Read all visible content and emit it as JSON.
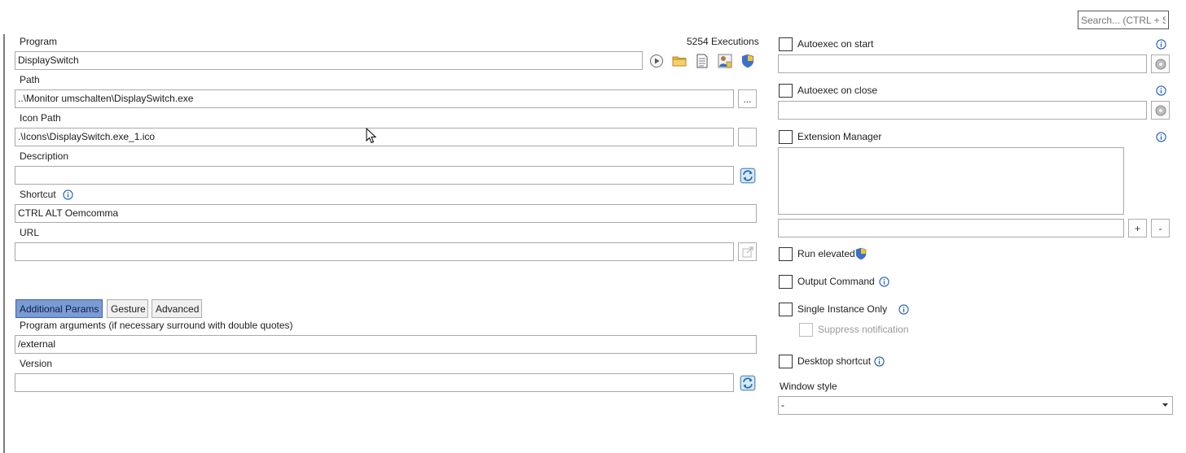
{
  "search": {
    "placeholder": "Search... (CTRL + S)"
  },
  "program": {
    "label": "Program",
    "executions": "5254 Executions",
    "value": "DisplaySwitch"
  },
  "path": {
    "label": "Path",
    "value": "..\\Monitor umschalten\\DisplaySwitch.exe",
    "browse_label": "..."
  },
  "icon_path": {
    "label": "Icon Path",
    "value": ".\\Icons\\DisplaySwitch.exe_1.ico"
  },
  "description": {
    "label": "Description",
    "value": ""
  },
  "shortcut": {
    "label": "Shortcut",
    "value": "CTRL ALT Oemcomma"
  },
  "url": {
    "label": "URL",
    "value": ""
  },
  "tabs": [
    {
      "label": "Additional Params"
    },
    {
      "label": "Gesture"
    },
    {
      "label": "Advanced"
    }
  ],
  "params": {
    "arguments_label": "Program arguments (if necessary surround with double quotes)",
    "arguments_value": "/external",
    "version_label": "Version",
    "version_value": ""
  },
  "right": {
    "autoexec_start": "Autoexec on start",
    "autoexec_close": "Autoexec on close",
    "extension_manager": "Extension Manager",
    "add_label": "+",
    "remove_label": "-",
    "run_elevated": "Run elevated",
    "output_command": "Output Command",
    "single_instance": "Single Instance Only",
    "suppress_notification": "Suppress notification",
    "desktop_shortcut": "Desktop shortcut",
    "window_style_label": "Window style",
    "window_style_value": "-"
  },
  "colors": {
    "active_tab": "#7a9bd4",
    "info_icon": "#1f5fbf",
    "folder_icon": "#e8b84a"
  }
}
